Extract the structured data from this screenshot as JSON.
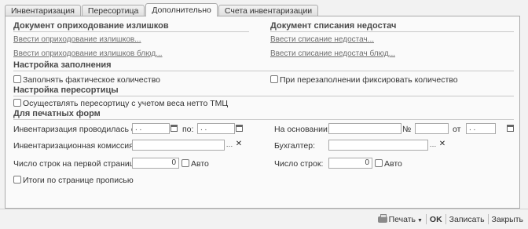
{
  "tabs": [
    {
      "label": "Инвентаризация",
      "active": false
    },
    {
      "label": "Пересортица",
      "active": false
    },
    {
      "label": "Дополнительно",
      "active": true
    },
    {
      "label": "Счета инвентаризации",
      "active": false
    }
  ],
  "surplus": {
    "title": "Документ оприходование излишков",
    "link1": "Ввести оприходование излишков...",
    "link2": "Ввести оприходование излишков блюд..."
  },
  "shortage": {
    "title": "Документ списания недостач",
    "link1": "Ввести списание недостач...",
    "link2": "Ввести списание недостач блюд..."
  },
  "fill": {
    "title": "Настройка заполнения",
    "fill_actual": "Заполнять фактическое количество",
    "fix_qty": "При перезаполнении фиксировать количество"
  },
  "regrade": {
    "title": "Настройка пересортицы",
    "net_weight": "Осуществлять пересортицу с учетом веса нетто ТМЦ"
  },
  "print": {
    "title": "Для печатных форм",
    "date_label": "Инвентаризация проводилась с:",
    "date_from": " .  .",
    "to_label": "по:",
    "date_to": " .  .",
    "commission_label": "Инвентаризационная комиссия:",
    "commission_value": "",
    "rows_first_label": "Число строк на первой странице:",
    "rows_first_value": "0",
    "auto_label": "Авто",
    "totals_label": "Итоги по странице прописью",
    "basis_label": "На основании:",
    "basis_value": "",
    "number_label": "№",
    "number_value": "",
    "from_label": "от",
    "from_date": " .  .",
    "accountant_label": "Бухгалтер:",
    "accountant_value": "",
    "rows_label": "Число строк:",
    "rows_value": "0",
    "auto2_label": "Авто"
  },
  "footer": {
    "print": "Печать",
    "ok": "OK",
    "save": "Записать",
    "close": "Закрыть"
  }
}
